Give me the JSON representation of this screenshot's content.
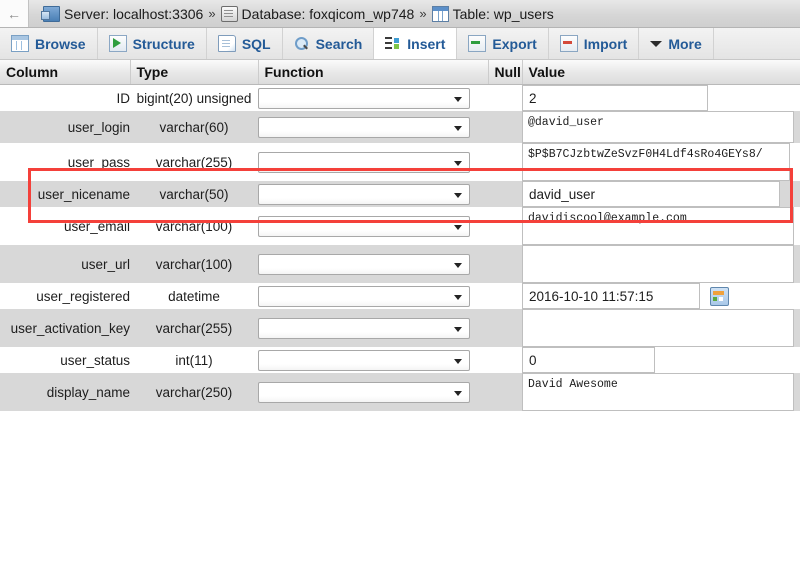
{
  "breadcrumb": {
    "back_label": "←",
    "server": "Server: localhost:3306",
    "database": "Database: foxqicom_wp748",
    "table": "Table: wp_users",
    "separator": "»"
  },
  "tabs": [
    {
      "label": "Browse",
      "icon": "browse-icon",
      "active": false
    },
    {
      "label": "Structure",
      "icon": "structure-icon",
      "active": false
    },
    {
      "label": "SQL",
      "icon": "sql-icon",
      "active": false
    },
    {
      "label": "Search",
      "icon": "search-icon",
      "active": false
    },
    {
      "label": "Insert",
      "icon": "insert-icon",
      "active": true
    },
    {
      "label": "Export",
      "icon": "export-icon",
      "active": false
    },
    {
      "label": "Import",
      "icon": "import-icon",
      "active": false
    },
    {
      "label": "More",
      "icon": "chevron-down-icon",
      "active": false
    }
  ],
  "table_headers": {
    "column": "Column",
    "type": "Type",
    "function": "Function",
    "null": "Null",
    "value": "Value"
  },
  "rows": [
    {
      "column": "ID",
      "type": "bigint(20) unsigned",
      "function": "",
      "null": "",
      "value": "2",
      "input_kind": "text"
    },
    {
      "column": "user_login",
      "type": "varchar(60)",
      "function": "",
      "null": "",
      "value": "@david_user",
      "input_kind": "textarea"
    },
    {
      "column": "user_pass",
      "type": "varchar(255)",
      "function": "",
      "null": "",
      "value": "$P$B7CJzbtwZeSvzF0H4Ldf4sRo4GEYs8/",
      "input_kind": "textarea",
      "highlighted": true
    },
    {
      "column": "user_nicename",
      "type": "varchar(50)",
      "function": "",
      "null": "",
      "value": "david_user",
      "input_kind": "text"
    },
    {
      "column": "user_email",
      "type": "varchar(100)",
      "function": "",
      "null": "",
      "value": "davidiscool@example.com",
      "input_kind": "textarea"
    },
    {
      "column": "user_url",
      "type": "varchar(100)",
      "function": "",
      "null": "",
      "value": "",
      "input_kind": "textarea"
    },
    {
      "column": "user_registered",
      "type": "datetime",
      "function": "",
      "null": "",
      "value": "2016-10-10 11:57:15",
      "input_kind": "text",
      "has_calendar": true
    },
    {
      "column": "user_activation_key",
      "type": "varchar(255)",
      "function": "",
      "null": "",
      "value": "",
      "input_kind": "textarea"
    },
    {
      "column": "user_status",
      "type": "int(11)",
      "function": "",
      "null": "",
      "value": "0",
      "input_kind": "text"
    },
    {
      "column": "display_name",
      "type": "varchar(250)",
      "function": "",
      "null": "",
      "value": "David Awesome",
      "input_kind": "textarea"
    }
  ],
  "colors": {
    "accent": "#235a97",
    "highlight": "#f4403a",
    "row_even": "#d8d8d8",
    "row_odd": "#ffffff"
  }
}
